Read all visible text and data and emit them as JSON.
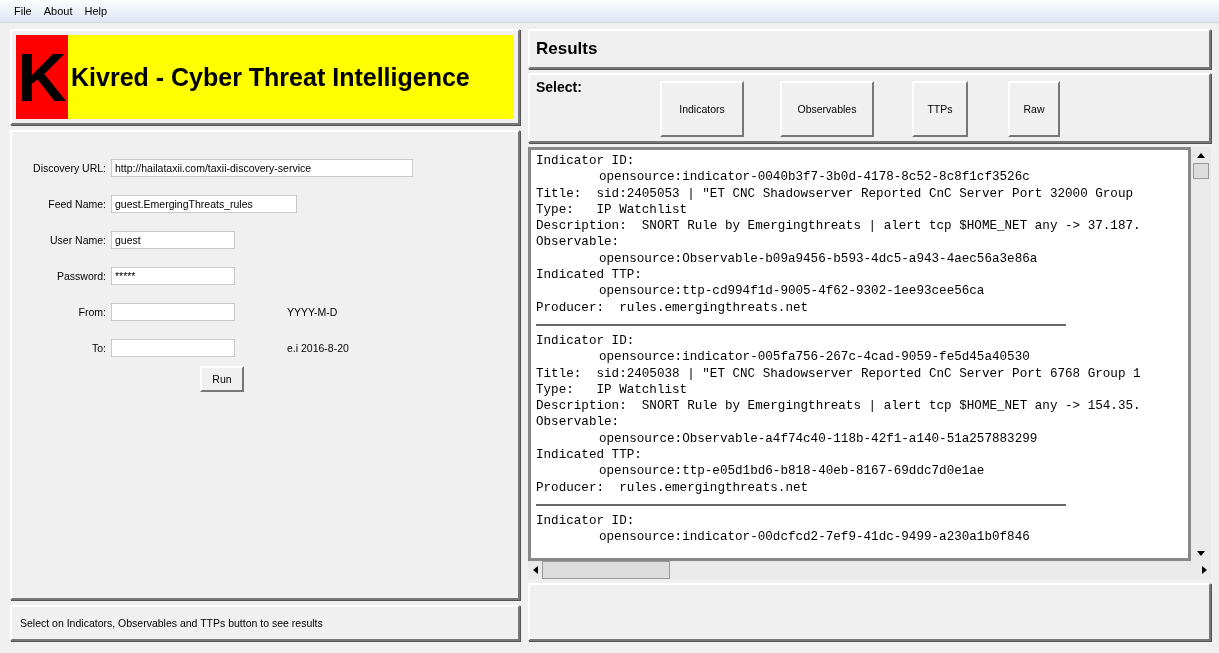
{
  "menu": [
    "File",
    "About",
    "Help"
  ],
  "banner": {
    "logo_letter": "K",
    "title": "Kivred - Cyber Threat Intelligence"
  },
  "form": {
    "fields": [
      {
        "label": "Discovery URL:",
        "value": "http://hailataxii.com/taxii-discovery-service"
      },
      {
        "label": "Feed Name:",
        "value": "guest.EmergingThreats_rules"
      },
      {
        "label": "User Name:",
        "value": "guest"
      },
      {
        "label": "Password:",
        "value": "*****"
      },
      {
        "label": "From:",
        "hint": "YYYY-M-D"
      },
      {
        "label": "To:",
        "hint": "e.i   2016-8-20"
      }
    ],
    "run_button": "Run"
  },
  "status_bar": "Select on Indicators, Observables and TTPs button to see results",
  "results": {
    "title": "Results",
    "select_label": "Select:",
    "buttons": [
      "Indicators",
      "Observables",
      "TTPs",
      "Raw"
    ],
    "records": [
      {
        "lines": [
          {
            "kind": "head",
            "text": "Indicator ID:"
          },
          {
            "kind": "indent",
            "text": "opensource:indicator-0040b3f7-3b0d-4178-8c52-8c8f1cf3526c"
          },
          {
            "kind": "head",
            "text": "Title:  sid:2405053 | \"ET CNC Shadowserver Reported CnC Server Port 32000 Group"
          },
          {
            "kind": "head",
            "text": "Type:   IP Watchlist"
          },
          {
            "kind": "head",
            "text": "Description:  SNORT Rule by Emergingthreats | alert tcp $HOME_NET any -> 37.187."
          },
          {
            "kind": "head",
            "text": "Observable:"
          },
          {
            "kind": "indent",
            "text": "opensource:Observable-b09a9456-b593-4dc5-a943-4aec56a3e86a"
          },
          {
            "kind": "head",
            "text": "Indicated TTP:"
          },
          {
            "kind": "indent",
            "text": "opensource:ttp-cd994f1d-9005-4f62-9302-1ee93cee56ca"
          },
          {
            "kind": "head",
            "text": "Producer:  rules.emergingthreats.net"
          },
          {
            "kind": "rule"
          }
        ]
      },
      {
        "lines": [
          {
            "kind": "head",
            "text": "Indicator ID:"
          },
          {
            "kind": "indent",
            "text": "opensource:indicator-005fa756-267c-4cad-9059-fe5d45a40530"
          },
          {
            "kind": "head",
            "text": "Title:  sid:2405038 | \"ET CNC Shadowserver Reported CnC Server Port 6768 Group 1"
          },
          {
            "kind": "head",
            "text": "Type:   IP Watchlist"
          },
          {
            "kind": "head",
            "text": "Description:  SNORT Rule by Emergingthreats | alert tcp $HOME_NET any -> 154.35."
          },
          {
            "kind": "head",
            "text": "Observable:"
          },
          {
            "kind": "indent",
            "text": "opensource:Observable-a4f74c40-118b-42f1-a140-51a257883299"
          },
          {
            "kind": "head",
            "text": "Indicated TTP:"
          },
          {
            "kind": "indent",
            "text": "opensource:ttp-e05d1bd6-b818-40eb-8167-69ddc7d0e1ae"
          },
          {
            "kind": "head",
            "text": "Producer:  rules.emergingthreats.net"
          },
          {
            "kind": "rule"
          }
        ]
      },
      {
        "lines": [
          {
            "kind": "head",
            "text": "Indicator ID:"
          },
          {
            "kind": "indent",
            "text": "opensource:indicator-00dcfcd2-7ef9-41dc-9499-a230a1b0f846"
          }
        ]
      }
    ]
  }
}
